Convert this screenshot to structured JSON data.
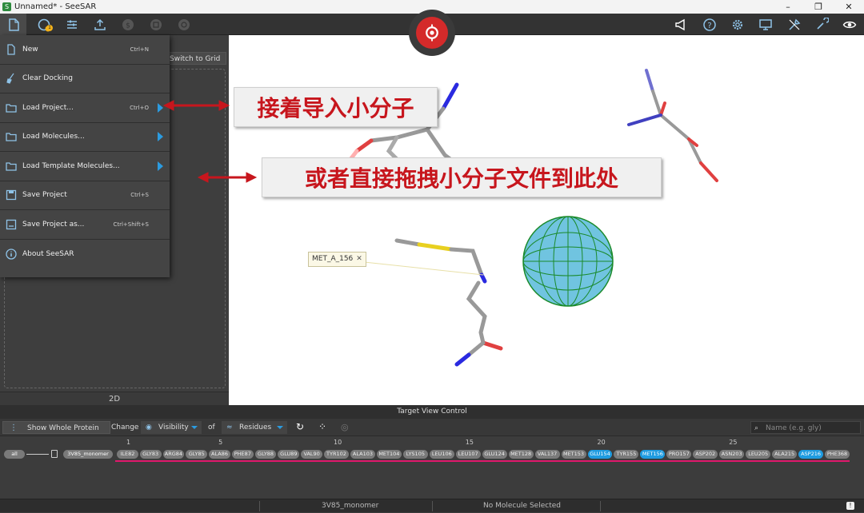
{
  "window": {
    "title": "Unnamed* - SeeSAR",
    "app_icon": "S",
    "controls": [
      "–",
      "❐",
      "✕"
    ]
  },
  "toolbar": {
    "left_icons": [
      "file-menu-icon",
      "analyzer-icon",
      "settings-sliders-icon",
      "export-icon",
      "dollar-icon",
      "box-icon",
      "target-icon"
    ],
    "badge": "1",
    "right_icons": [
      "megaphone-icon",
      "help-icon",
      "gear-icon",
      "monitor-icon",
      "tools-icon",
      "wrench-icon",
      "eye-icon"
    ]
  },
  "menu": {
    "items": [
      {
        "label": "New",
        "shortcut": "Ctrl+N",
        "icon": "new-file-icon",
        "submenu": false
      },
      {
        "label": "Clear Docking",
        "shortcut": "",
        "icon": "broom-icon",
        "submenu": false
      },
      {
        "label": "Load Project...",
        "shortcut": "Ctrl+O",
        "icon": "folder-open-icon",
        "submenu": true
      },
      {
        "label": "Load Molecules...",
        "shortcut": "",
        "icon": "folder-open-icon",
        "submenu": true
      },
      {
        "label": "Load Template Molecules...",
        "shortcut": "",
        "icon": "folder-open-icon",
        "submenu": true
      },
      {
        "label": "Save Project",
        "shortcut": "Ctrl+S",
        "icon": "save-icon",
        "submenu": false
      },
      {
        "label": "Save Project as...",
        "shortcut": "Ctrl+Shift+S",
        "icon": "save-as-icon",
        "submenu": false
      },
      {
        "label": "About SeeSAR",
        "shortcut": "",
        "icon": "info-icon",
        "submenu": false
      }
    ]
  },
  "left_panel": {
    "switch_grid": "Switch to Grid",
    "label_2d": "2D"
  },
  "annotations": {
    "callout1": "接着导入小分子",
    "callout2": "或者直接拖拽小分子文件到此处",
    "accent": "#c7161d"
  },
  "viewport": {
    "residue_tag": "MET_A_156",
    "tag_close": "✕"
  },
  "target_view": {
    "title": "Target View Control",
    "show_whole": "Show Whole Protein",
    "change": "Change",
    "visibility": "Visibility",
    "of": "of",
    "residues": "Residues",
    "search_placeholder": "Name (e.g. gly)"
  },
  "sequence": {
    "all": "all",
    "monomer": "3V85_monomer",
    "ruler": [
      "1",
      "5",
      "10",
      "15",
      "20",
      "25"
    ],
    "residues": [
      "ILE82",
      "GLY83",
      "ARG84",
      "GLY85",
      "ALA86",
      "PHE87",
      "GLY88",
      "GLU89",
      "VAL90",
      "TYR102",
      "ALA103",
      "MET104",
      "LYS105",
      "LEU106",
      "LEU107",
      "GLU124",
      "MET128",
      "VAL137",
      "MET153",
      "GLU154",
      "TYR155",
      "MET156",
      "PRO157",
      "ASP202",
      "ASN203",
      "LEU205",
      "ALA215",
      "ASP216",
      "PHE368"
    ],
    "selected": [
      "GLU154",
      "MET156",
      "ASP216"
    ]
  },
  "status": {
    "structure": "3V85_monomer",
    "selection": "No Molecule Selected",
    "notice": "!"
  }
}
